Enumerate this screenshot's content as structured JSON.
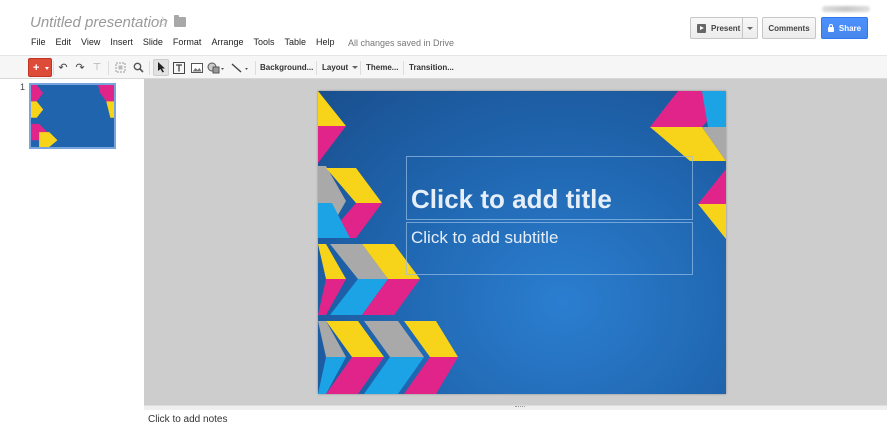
{
  "header": {
    "title": "Untitled presentation",
    "save_status": "All changes saved in Drive"
  },
  "menu": [
    "File",
    "Edit",
    "View",
    "Insert",
    "Slide",
    "Format",
    "Arrange",
    "Tools",
    "Table",
    "Help"
  ],
  "actions": {
    "present_label": "Present",
    "comments_label": "Comments",
    "share_label": "Share"
  },
  "toolbar": {
    "new_slide": "+",
    "background": "Background...",
    "layout": "Layout",
    "theme": "Theme...",
    "transition": "Transition..."
  },
  "filmstrip": {
    "slide_number": "1"
  },
  "slide": {
    "title_placeholder": "Click to add title",
    "subtitle_placeholder": "Click to add subtitle"
  },
  "notes": {
    "placeholder": "Click to add notes"
  },
  "colors": {
    "slide_blue": "#1f64ad",
    "magenta": "#e0248a",
    "yellow": "#f7d31a",
    "cyan": "#1ba3e6",
    "gray": "#a9a9a9",
    "share_blue": "#4787ed",
    "new_slide_red": "#dd4b39"
  }
}
